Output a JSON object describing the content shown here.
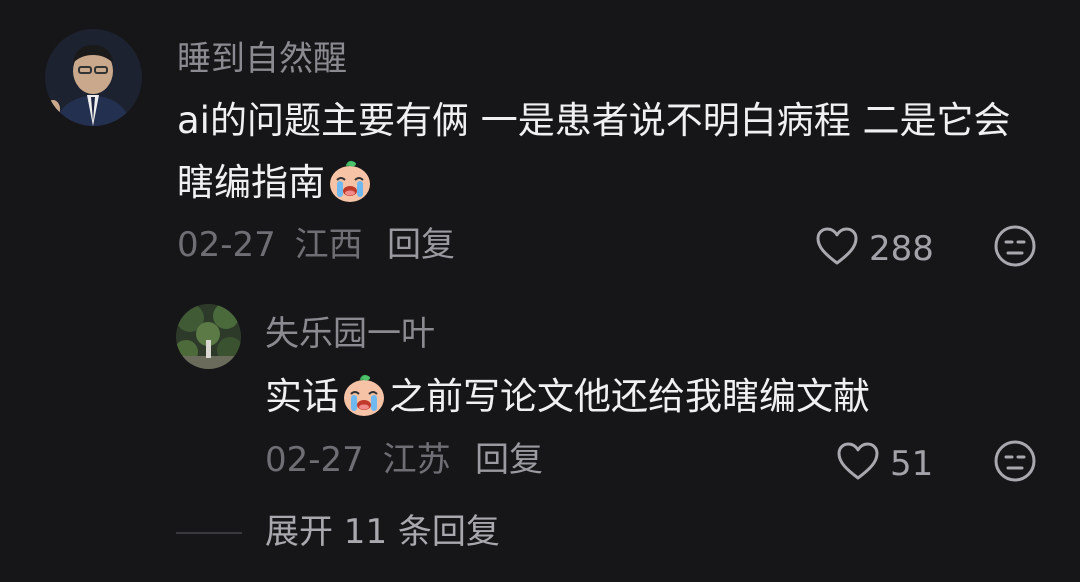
{
  "comments": [
    {
      "username": "睡到自然醒",
      "text_line1": "ai的问题主要有俩 一是患者说不明白病程 二是它会",
      "text_line2": "瞎编指南",
      "emoji": "crying-face-emoji",
      "date": "02-27",
      "location": "江西",
      "reply_label": "回复",
      "like_count": "288"
    }
  ],
  "replies": [
    {
      "username": "失乐园一叶",
      "text_before": "实话",
      "emoji": "crying-face-emoji",
      "text_after": "之前写论文他还给我瞎编文献",
      "date": "02-27",
      "location": "江苏",
      "reply_label": "回复",
      "like_count": "51"
    }
  ],
  "expand": {
    "label": "展开 11 条回复"
  },
  "icons": {
    "like": "heart-outline-icon",
    "dislike": "unamused-face-icon"
  },
  "colors": {
    "background": "#161619",
    "text": "#f0f0f2",
    "username": "#8a8a90",
    "meta": "#6e6e74"
  }
}
